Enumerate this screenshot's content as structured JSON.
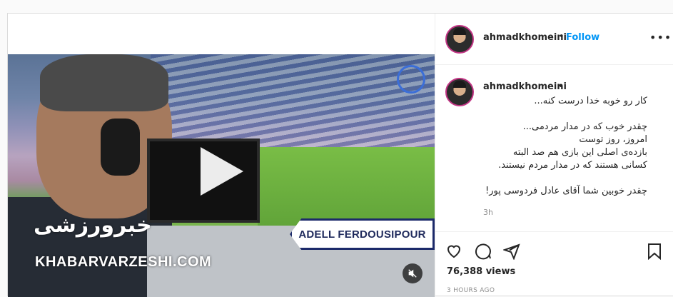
{
  "media": {
    "name_banner": "ADELL FERDOUSIPOUR",
    "watermark_logo": "خبرورزشی",
    "watermark_text": "KHABARVARZESHI.COM",
    "play_icon": "play-icon",
    "mute_icon": "muted-speaker-icon"
  },
  "header": {
    "username": "ahmadkhomeini",
    "separator": "•",
    "follow_label": "Follow",
    "more_icon": "more-options-icon"
  },
  "caption": {
    "username": "ahmadkhomeini",
    "separator": "•",
    "lines": [
      "کار رو خوبه خدا درست کنه...",
      "",
      "چقدر خوب که در مدار مردمی...",
      "امروز، روز توست",
      "بازده‌ی اصلی این بازی هم صد البته",
      "کسانی هستند که در مدار مردم نیستند.",
      "",
      "چقدر خوبین شما آقای عادل فردوسی پور!"
    ],
    "time": "3h"
  },
  "actions": {
    "like_icon": "heart-icon",
    "comment_icon": "comment-icon",
    "share_icon": "share-icon",
    "save_icon": "bookmark-icon",
    "views": "76,388 views",
    "posted": "3 HOURS AGO"
  },
  "colors": {
    "follow": "#0095f6",
    "avatar_ring": "#c13584",
    "banner_border": "#1c2a6a"
  }
}
